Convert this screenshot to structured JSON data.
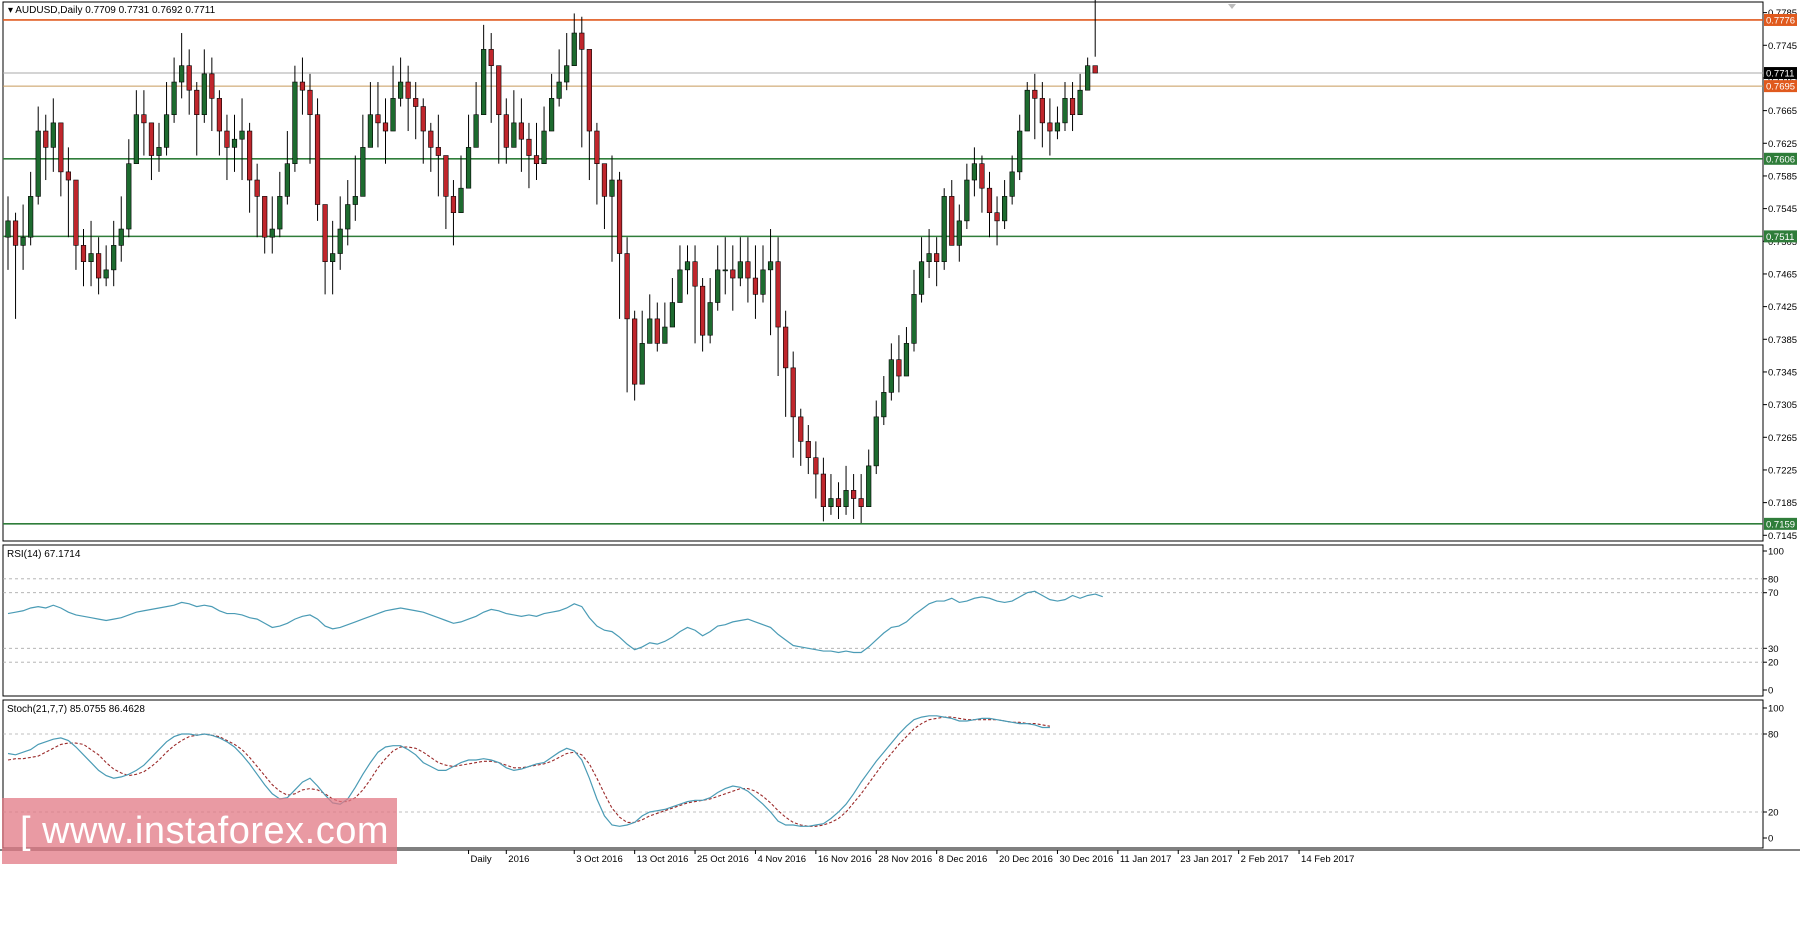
{
  "header": {
    "symbol": "AUDUSD,Daily",
    "ohlc": "0.7709 0.7731 0.7692 0.7711"
  },
  "rsi_label": "RSI(14) 67.1714",
  "stoch_label": "Stoch(21,7,7) 85.0755 86.4628",
  "watermark": "[ www.instaforex.com ]",
  "colors": {
    "bull": "#1d6b2f",
    "bear": "#c0262c",
    "resistance": "#e05a1e",
    "support": "#2f7d3a",
    "gray_line": "#aaaaaa",
    "orange_line": "#c79a5b",
    "rsi": "#4a9bb5",
    "stoch_main": "#4a9bb5",
    "stoch_signal": "#9b2b2b"
  },
  "chart_data": [
    {
      "type": "candlestick",
      "title": "AUDUSD,Daily",
      "ylim": [
        0.7138,
        0.7798
      ],
      "y_ticks": [
        0.7785,
        0.7745,
        0.7705,
        0.7665,
        0.7625,
        0.7585,
        0.7545,
        0.7505,
        0.7465,
        0.7425,
        0.7385,
        0.7345,
        0.7305,
        0.7265,
        0.7225,
        0.7185,
        0.7145
      ],
      "x_labels": [
        {
          "label": "Daily",
          "index": 61
        },
        {
          "label": "2016",
          "index": 66
        },
        {
          "label": "3 Oct 2016",
          "index": 75
        },
        {
          "label": "13 Oct 2016",
          "index": 83
        },
        {
          "label": "25 Oct 2016",
          "index": 91
        },
        {
          "label": "4 Nov 2016",
          "index": 99
        },
        {
          "label": "16 Nov 2016",
          "index": 107
        },
        {
          "label": "28 Nov 2016",
          "index": 115
        },
        {
          "label": "8 Dec 2016",
          "index": 123
        },
        {
          "label": "20 Dec 2016",
          "index": 131
        },
        {
          "label": "30 Dec 2016",
          "index": 139
        },
        {
          "label": "11 Jan 2017",
          "index": 147
        },
        {
          "label": "23 Jan 2017",
          "index": 155
        },
        {
          "label": "2 Feb 2017",
          "index": 163
        },
        {
          "label": "14 Feb 2017",
          "index": 171
        }
      ],
      "levels": [
        {
          "value": 0.7776,
          "label": "0.7776",
          "kind": "resistance"
        },
        {
          "value": 0.7711,
          "label": "0.7711",
          "kind": "current"
        },
        {
          "value": 0.7695,
          "label": "0.7695",
          "kind": "orange"
        },
        {
          "value": 0.7606,
          "label": "0.7606",
          "kind": "support"
        },
        {
          "value": 0.7511,
          "label": "0.7511",
          "kind": "support"
        },
        {
          "value": 0.7159,
          "label": "0.7159",
          "kind": "support"
        }
      ],
      "closes": [
        0.753,
        0.75,
        0.751,
        0.756,
        0.764,
        0.762,
        0.765,
        0.759,
        0.758,
        0.75,
        0.748,
        0.749,
        0.746,
        0.747,
        0.75,
        0.752,
        0.76,
        0.766,
        0.765,
        0.761,
        0.762,
        0.766,
        0.77,
        0.772,
        0.769,
        0.766,
        0.771,
        0.768,
        0.764,
        0.762,
        0.763,
        0.764,
        0.758,
        0.756,
        0.751,
        0.752,
        0.756,
        0.76,
        0.77,
        0.769,
        0.766,
        0.755,
        0.748,
        0.749,
        0.752,
        0.755,
        0.756,
        0.762,
        0.766,
        0.765,
        0.764,
        0.768,
        0.77,
        0.768,
        0.767,
        0.764,
        0.762,
        0.761,
        0.756,
        0.754,
        0.757,
        0.762,
        0.766,
        0.774,
        0.772,
        0.766,
        0.762,
        0.765,
        0.763,
        0.761,
        0.76,
        0.764,
        0.768,
        0.77,
        0.772,
        0.776,
        0.774,
        0.764,
        0.76,
        0.756,
        0.758,
        0.749,
        0.741,
        0.733,
        0.738,
        0.741,
        0.738,
        0.74,
        0.743,
        0.747,
        0.748,
        0.745,
        0.739,
        0.743,
        0.747,
        0.747,
        0.746,
        0.748,
        0.746,
        0.744,
        0.747,
        0.748,
        0.74,
        0.735,
        0.729,
        0.726,
        0.724,
        0.722,
        0.718,
        0.719,
        0.718,
        0.72,
        0.719,
        0.718,
        0.723,
        0.729,
        0.732,
        0.736,
        0.734,
        0.738,
        0.744,
        0.748,
        0.749,
        0.748,
        0.756,
        0.75,
        0.753,
        0.758,
        0.76,
        0.757,
        0.754,
        0.753,
        0.756,
        0.759,
        0.764,
        0.769,
        0.768,
        0.765,
        0.764,
        0.765,
        0.768,
        0.766,
        0.769,
        0.772,
        0.7711
      ],
      "highs": [
        0.756,
        0.754,
        0.755,
        0.759,
        0.767,
        0.766,
        0.768,
        0.764,
        0.762,
        0.756,
        0.752,
        0.753,
        0.751,
        0.75,
        0.753,
        0.756,
        0.763,
        0.769,
        0.769,
        0.765,
        0.765,
        0.77,
        0.773,
        0.776,
        0.774,
        0.77,
        0.774,
        0.773,
        0.769,
        0.766,
        0.766,
        0.768,
        0.765,
        0.76,
        0.756,
        0.756,
        0.759,
        0.764,
        0.772,
        0.773,
        0.771,
        0.768,
        0.755,
        0.753,
        0.756,
        0.758,
        0.761,
        0.766,
        0.77,
        0.77,
        0.768,
        0.772,
        0.773,
        0.772,
        0.77,
        0.768,
        0.765,
        0.766,
        0.761,
        0.758,
        0.761,
        0.766,
        0.77,
        0.777,
        0.776,
        0.772,
        0.768,
        0.769,
        0.768,
        0.765,
        0.765,
        0.767,
        0.771,
        0.774,
        0.776,
        0.7784,
        0.778,
        0.772,
        0.765,
        0.76,
        0.761,
        0.759,
        0.751,
        0.742,
        0.742,
        0.744,
        0.743,
        0.743,
        0.746,
        0.75,
        0.75,
        0.75,
        0.746,
        0.746,
        0.75,
        0.751,
        0.75,
        0.751,
        0.751,
        0.75,
        0.75,
        0.752,
        0.751,
        0.742,
        0.737,
        0.73,
        0.728,
        0.726,
        0.724,
        0.722,
        0.721,
        0.723,
        0.722,
        0.722,
        0.725,
        0.731,
        0.734,
        0.738,
        0.739,
        0.74,
        0.747,
        0.751,
        0.752,
        0.751,
        0.757,
        0.758,
        0.755,
        0.76,
        0.762,
        0.761,
        0.759,
        0.756,
        0.758,
        0.761,
        0.766,
        0.77,
        0.771,
        0.77,
        0.768,
        0.767,
        0.77,
        0.77,
        0.771,
        0.773,
        0.7731
      ],
      "lows": [
        0.747,
        0.741,
        0.747,
        0.75,
        0.755,
        0.758,
        0.759,
        0.756,
        0.751,
        0.747,
        0.745,
        0.745,
        0.744,
        0.745,
        0.745,
        0.748,
        0.751,
        0.76,
        0.761,
        0.758,
        0.759,
        0.761,
        0.765,
        0.768,
        0.766,
        0.761,
        0.765,
        0.764,
        0.761,
        0.758,
        0.759,
        0.758,
        0.754,
        0.751,
        0.749,
        0.749,
        0.751,
        0.755,
        0.759,
        0.766,
        0.76,
        0.753,
        0.744,
        0.744,
        0.747,
        0.75,
        0.753,
        0.758,
        0.762,
        0.762,
        0.76,
        0.764,
        0.767,
        0.764,
        0.763,
        0.76,
        0.759,
        0.756,
        0.752,
        0.75,
        0.754,
        0.758,
        0.763,
        0.769,
        0.765,
        0.76,
        0.76,
        0.762,
        0.759,
        0.757,
        0.758,
        0.761,
        0.764,
        0.767,
        0.769,
        0.772,
        0.762,
        0.758,
        0.755,
        0.752,
        0.748,
        0.741,
        0.732,
        0.731,
        0.734,
        0.738,
        0.737,
        0.738,
        0.74,
        0.743,
        0.744,
        0.738,
        0.737,
        0.738,
        0.742,
        0.744,
        0.742,
        0.745,
        0.743,
        0.741,
        0.743,
        0.739,
        0.734,
        0.729,
        0.724,
        0.723,
        0.722,
        0.719,
        0.7162,
        0.717,
        0.7165,
        0.717,
        0.7165,
        0.716,
        0.718,
        0.722,
        0.728,
        0.731,
        0.732,
        0.734,
        0.737,
        0.743,
        0.746,
        0.745,
        0.747,
        0.75,
        0.748,
        0.752,
        0.756,
        0.754,
        0.751,
        0.75,
        0.752,
        0.755,
        0.758,
        0.764,
        0.763,
        0.762,
        0.761,
        0.763,
        0.764,
        0.764,
        0.766,
        0.7692
      ]
    },
    {
      "type": "line",
      "title": "RSI(14) 67.1714",
      "ylim": [
        0,
        100
      ],
      "y_ticks": [
        100,
        80,
        70,
        30,
        20,
        0
      ],
      "grid_levels": [
        80,
        70,
        30,
        20
      ],
      "values": [
        55,
        56,
        57,
        59,
        60,
        59,
        61,
        59,
        56,
        54,
        53,
        52,
        51,
        50,
        51,
        52,
        54,
        56,
        57,
        58,
        59,
        60,
        61,
        63,
        62,
        60,
        61,
        60,
        57,
        55,
        55,
        54,
        52,
        51,
        48,
        45,
        46,
        48,
        51,
        53,
        54,
        51,
        46,
        44,
        45,
        47,
        49,
        51,
        53,
        55,
        57,
        58,
        59,
        58,
        57,
        56,
        54,
        52,
        50,
        48,
        49,
        51,
        53,
        56,
        58,
        57,
        55,
        54,
        53,
        54,
        53,
        55,
        56,
        57,
        59,
        62,
        60,
        52,
        46,
        43,
        42,
        38,
        33,
        29,
        31,
        34,
        33,
        35,
        38,
        42,
        45,
        43,
        39,
        42,
        46,
        47,
        49,
        50,
        51,
        49,
        47,
        45,
        40,
        36,
        32,
        31,
        30,
        29,
        28,
        28,
        27,
        28,
        27,
        27,
        31,
        36,
        41,
        45,
        46,
        49,
        54,
        58,
        62,
        64,
        64,
        66,
        63,
        64,
        66,
        67,
        66,
        64,
        63,
        64,
        67,
        70,
        71,
        68,
        65,
        64,
        65,
        68,
        66,
        68,
        69,
        67.17
      ]
    },
    {
      "type": "line",
      "title": "Stoch(21,7,7) 85.0755 86.4628",
      "ylim": [
        0,
        100
      ],
      "y_ticks": [
        100,
        80,
        20,
        0
      ],
      "grid_levels": [
        80,
        20
      ],
      "series": [
        {
          "name": "main",
          "values": [
            65,
            64,
            66,
            68,
            72,
            74,
            76,
            77,
            75,
            70,
            64,
            58,
            52,
            48,
            46,
            47,
            49,
            52,
            56,
            62,
            68,
            74,
            78,
            80,
            80,
            79,
            80,
            79,
            77,
            74,
            70,
            64,
            57,
            49,
            41,
            34,
            30,
            31,
            37,
            43,
            46,
            40,
            33,
            27,
            26,
            30,
            39,
            49,
            58,
            66,
            70,
            71,
            71,
            68,
            64,
            58,
            55,
            52,
            52,
            55,
            58,
            60,
            60,
            61,
            60,
            58,
            54,
            52,
            53,
            55,
            57,
            58,
            62,
            66,
            69,
            67,
            60,
            46,
            30,
            17,
            10,
            9,
            10,
            12,
            17,
            20,
            21,
            22,
            24,
            26,
            28,
            29,
            29,
            31,
            35,
            38,
            40,
            39,
            36,
            31,
            26,
            20,
            13,
            10,
            10,
            9,
            9,
            10,
            11,
            15,
            20,
            26,
            34,
            43,
            51,
            59,
            66,
            73,
            80,
            86,
            91,
            93,
            94,
            94,
            93,
            92,
            90,
            90,
            91,
            92,
            92,
            91,
            90,
            89,
            88,
            88,
            87,
            85,
            85
          ]
        },
        {
          "name": "signal",
          "values": [
            60,
            61,
            61,
            62,
            63,
            66,
            69,
            72,
            73,
            73,
            72,
            68,
            64,
            58,
            53,
            50,
            48,
            49,
            51,
            55,
            60,
            66,
            71,
            75,
            78,
            79,
            80,
            79,
            78,
            75,
            72,
            68,
            62,
            55,
            48,
            41,
            36,
            33,
            34,
            37,
            38,
            37,
            34,
            30,
            28,
            28,
            31,
            37,
            45,
            54,
            61,
            67,
            70,
            70,
            69,
            66,
            62,
            58,
            56,
            55,
            56,
            57,
            58,
            59,
            59,
            58,
            56,
            54,
            54,
            55,
            56,
            57,
            59,
            62,
            65,
            66,
            64,
            57,
            46,
            34,
            23,
            16,
            12,
            12,
            14,
            17,
            19,
            21,
            23,
            25,
            27,
            28,
            29,
            30,
            32,
            34,
            36,
            38,
            38,
            36,
            32,
            27,
            21,
            16,
            12,
            10,
            9,
            9,
            10,
            12,
            15,
            20,
            27,
            34,
            42,
            50,
            58,
            65,
            72,
            78,
            84,
            88,
            91,
            92,
            93,
            93,
            92,
            91,
            91,
            91,
            91,
            91,
            90,
            89,
            89,
            88,
            88,
            87,
            86
          ]
        }
      ]
    }
  ]
}
